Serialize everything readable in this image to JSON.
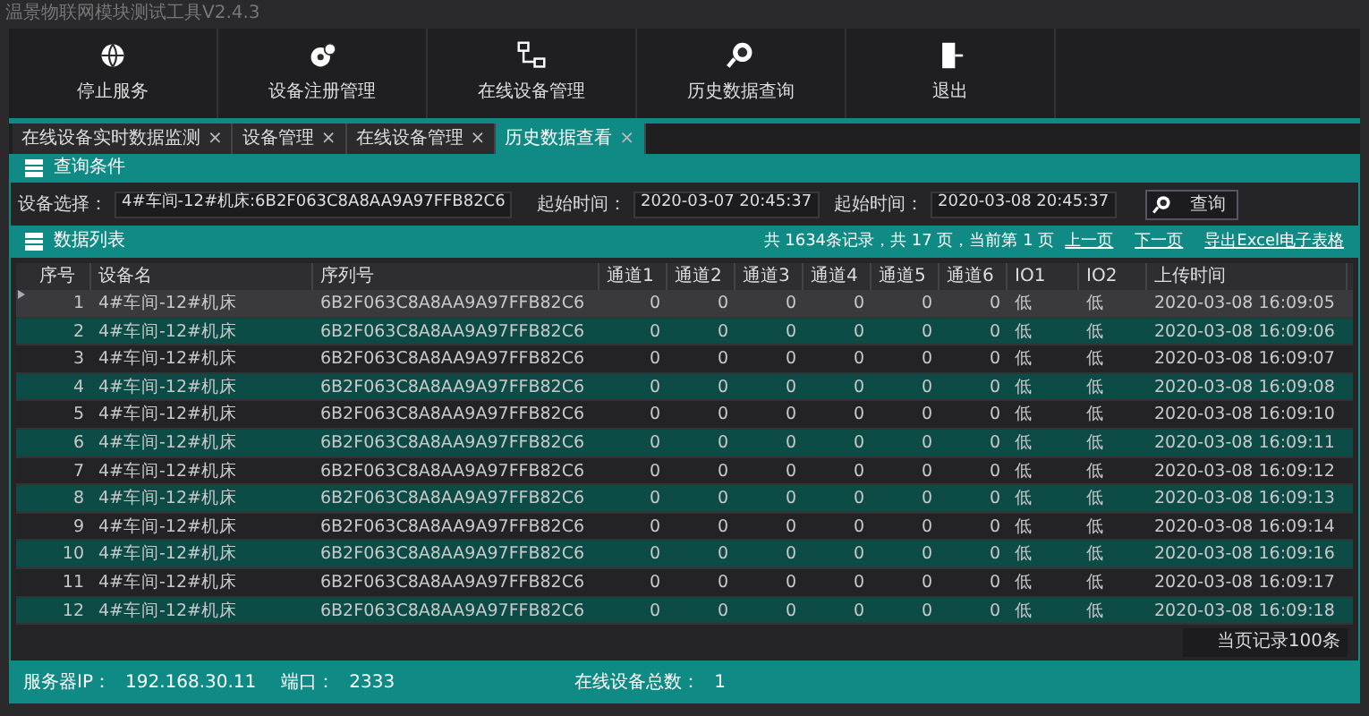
{
  "window": {
    "title": "温景物联网模块测试工具V2.4.3"
  },
  "toolbar": [
    {
      "kind": "globe",
      "label": "停止服务"
    },
    {
      "kind": "devices",
      "label": "设备注册管理"
    },
    {
      "kind": "network",
      "label": "在线设备管理"
    },
    {
      "kind": "search",
      "label": "历史数据查询"
    },
    {
      "kind": "exit",
      "label": "退出"
    }
  ],
  "tabs": [
    {
      "label": "在线设备实时数据监测",
      "close": "×",
      "selected": false
    },
    {
      "label": "设备管理",
      "close": "×",
      "selected": false
    },
    {
      "label": "在线设备管理",
      "close": "×",
      "selected": false
    },
    {
      "label": "历史数据查看",
      "close": "×",
      "selected": true
    }
  ],
  "query": {
    "title": "查询条件",
    "device_label": "设备选择：",
    "device_value": "4#车间-12#机床:6B2F063C8A8AA9A97FFB82C6",
    "start_label": "起始时间：",
    "start_value": "2020-03-07 20:45:37",
    "end_label": "起始时间：",
    "end_value": "2020-03-08 20:45:37",
    "button": "查询"
  },
  "list": {
    "title": "数据列表",
    "summary": "共 1634条记录，共 17 页，当前第 1 页",
    "prev": "上一页",
    "next": "下一页",
    "export": "导出Excel电子表格"
  },
  "table": {
    "columns": [
      "序号",
      "设备名",
      "序列号",
      "通道1",
      "通道2",
      "通道3",
      "通道4",
      "通道5",
      "通道6",
      "IO1",
      "IO2",
      "上传时间"
    ],
    "rows": [
      {
        "selected": true,
        "cells": [
          "1",
          "4#车间-12#机床",
          "6B2F063C8A8AA9A97FFB82C6",
          "0",
          "0",
          "0",
          "0",
          "0",
          "0",
          "低",
          "低",
          "2020-03-08 16:09:05"
        ]
      },
      {
        "selected": false,
        "cells": [
          "2",
          "4#车间-12#机床",
          "6B2F063C8A8AA9A97FFB82C6",
          "0",
          "0",
          "0",
          "0",
          "0",
          "0",
          "低",
          "低",
          "2020-03-08 16:09:06"
        ]
      },
      {
        "selected": false,
        "cells": [
          "3",
          "4#车间-12#机床",
          "6B2F063C8A8AA9A97FFB82C6",
          "0",
          "0",
          "0",
          "0",
          "0",
          "0",
          "低",
          "低",
          "2020-03-08 16:09:07"
        ]
      },
      {
        "selected": false,
        "cells": [
          "4",
          "4#车间-12#机床",
          "6B2F063C8A8AA9A97FFB82C6",
          "0",
          "0",
          "0",
          "0",
          "0",
          "0",
          "低",
          "低",
          "2020-03-08 16:09:08"
        ]
      },
      {
        "selected": false,
        "cells": [
          "5",
          "4#车间-12#机床",
          "6B2F063C8A8AA9A97FFB82C6",
          "0",
          "0",
          "0",
          "0",
          "0",
          "0",
          "低",
          "低",
          "2020-03-08 16:09:10"
        ]
      },
      {
        "selected": false,
        "cells": [
          "6",
          "4#车间-12#机床",
          "6B2F063C8A8AA9A97FFB82C6",
          "0",
          "0",
          "0",
          "0",
          "0",
          "0",
          "低",
          "低",
          "2020-03-08 16:09:11"
        ]
      },
      {
        "selected": false,
        "cells": [
          "7",
          "4#车间-12#机床",
          "6B2F063C8A8AA9A97FFB82C6",
          "0",
          "0",
          "0",
          "0",
          "0",
          "0",
          "低",
          "低",
          "2020-03-08 16:09:12"
        ]
      },
      {
        "selected": false,
        "cells": [
          "8",
          "4#车间-12#机床",
          "6B2F063C8A8AA9A97FFB82C6",
          "0",
          "0",
          "0",
          "0",
          "0",
          "0",
          "低",
          "低",
          "2020-03-08 16:09:13"
        ]
      },
      {
        "selected": false,
        "cells": [
          "9",
          "4#车间-12#机床",
          "6B2F063C8A8AA9A97FFB82C6",
          "0",
          "0",
          "0",
          "0",
          "0",
          "0",
          "低",
          "低",
          "2020-03-08 16:09:14"
        ]
      },
      {
        "selected": false,
        "cells": [
          "10",
          "4#车间-12#机床",
          "6B2F063C8A8AA9A97FFB82C6",
          "0",
          "0",
          "0",
          "0",
          "0",
          "0",
          "低",
          "低",
          "2020-03-08 16:09:16"
        ]
      },
      {
        "selected": false,
        "cells": [
          "11",
          "4#车间-12#机床",
          "6B2F063C8A8AA9A97FFB82C6",
          "0",
          "0",
          "0",
          "0",
          "0",
          "0",
          "低",
          "低",
          "2020-03-08 16:09:17"
        ]
      },
      {
        "selected": false,
        "cells": [
          "12",
          "4#车间-12#机床",
          "6B2F063C8A8AA9A97FFB82C6",
          "0",
          "0",
          "0",
          "0",
          "0",
          "0",
          "低",
          "低",
          "2020-03-08 16:09:18"
        ]
      }
    ]
  },
  "page_records": "当页记录100条",
  "status_bar": [
    {
      "label": "服务器IP：",
      "value": "192.168.30.11"
    },
    {
      "label": "端口：",
      "value": "2333"
    },
    {
      "label": "在线设备总数：",
      "value": "1"
    }
  ]
}
